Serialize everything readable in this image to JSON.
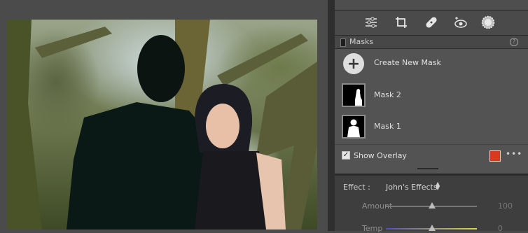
{
  "panel": {
    "masks_title": "Masks",
    "help_glyph": "?",
    "create_label": "Create New Mask",
    "create_glyph": "+",
    "masks": [
      {
        "label": "Mask 2"
      },
      {
        "label": "Mask 1"
      }
    ],
    "overlay_label": "Show Overlay",
    "overlay_checked": true,
    "overlay_color": "#d9391f",
    "more_glyph": "•••"
  },
  "toolbar": {
    "icons": [
      "sliders-icon",
      "crop-icon",
      "healing-bandage-icon",
      "red-eye-icon",
      "masking-icon"
    ]
  },
  "effects": {
    "label": "Effect :",
    "value": "John's Effects",
    "sliders": [
      {
        "label": "Amount",
        "value": "100",
        "level": 0.5
      },
      {
        "label": "Temp",
        "value": "0",
        "level": 0.5
      }
    ]
  }
}
